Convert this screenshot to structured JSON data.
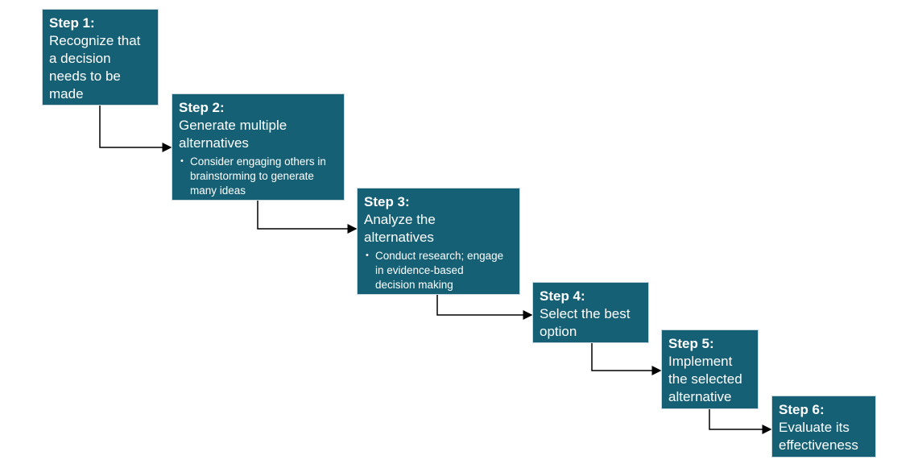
{
  "steps": [
    {
      "title": "Step 1:",
      "text": "Recognize that a decision needs to be made",
      "bullet": ""
    },
    {
      "title": "Step 2:",
      "text": "Generate multiple alternatives",
      "bullet": "Consider engaging others in brainstorming to generate many ideas"
    },
    {
      "title": "Step 3:",
      "text": "Analyze the alternatives",
      "bullet": "Conduct research; engage in evidence-based decision making"
    },
    {
      "title": "Step 4:",
      "text": "Select the best option",
      "bullet": ""
    },
    {
      "title": "Step 5:",
      "text": "Implement the selected alternative",
      "bullet": ""
    },
    {
      "title": "Step 6:",
      "text": "Evaluate its effectiveness",
      "bullet": ""
    }
  ],
  "colors": {
    "box": "#156074",
    "arrow": "#000000"
  }
}
